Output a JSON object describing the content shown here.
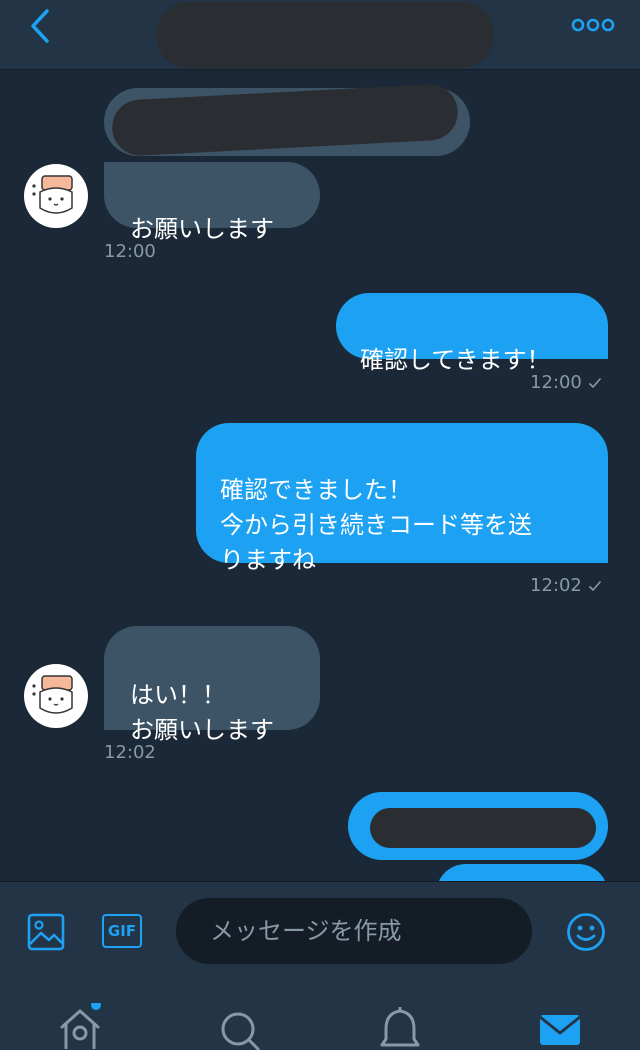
{
  "colors": {
    "background": "#1b2838",
    "header_bg": "#243447",
    "accent": "#1da1f2",
    "incoming_bubble": "#3d5466",
    "muted_text": "#8899a6",
    "redaction": "#2a2d31"
  },
  "header": {
    "back_icon": "chevron-left-icon",
    "more_icon": "more-dots-icon"
  },
  "messages": [
    {
      "direction": "in",
      "text": "お願いします",
      "time": "12:00"
    },
    {
      "direction": "out",
      "text": "確認してきます！",
      "time": "12:00",
      "status_icon": "check-icon"
    },
    {
      "direction": "out",
      "text": "確認できました！\n今から引き続きコード等を送\nりますね",
      "time": "12:02",
      "status_icon": "check-icon"
    },
    {
      "direction": "in",
      "text": "はい！！\nお願いします",
      "time": "12:02"
    }
  ],
  "composer": {
    "image_icon": "image-icon",
    "gif_label": "GIF",
    "placeholder": "メッセージを作成",
    "emoji_icon": "emoji-icon"
  },
  "tabbar": {
    "items": [
      {
        "name": "home",
        "icon": "home-icon",
        "notification_dot": true
      },
      {
        "name": "search",
        "icon": "search-icon"
      },
      {
        "name": "notifications",
        "icon": "bell-icon"
      },
      {
        "name": "messages",
        "icon": "mail-icon",
        "active": true
      }
    ]
  }
}
